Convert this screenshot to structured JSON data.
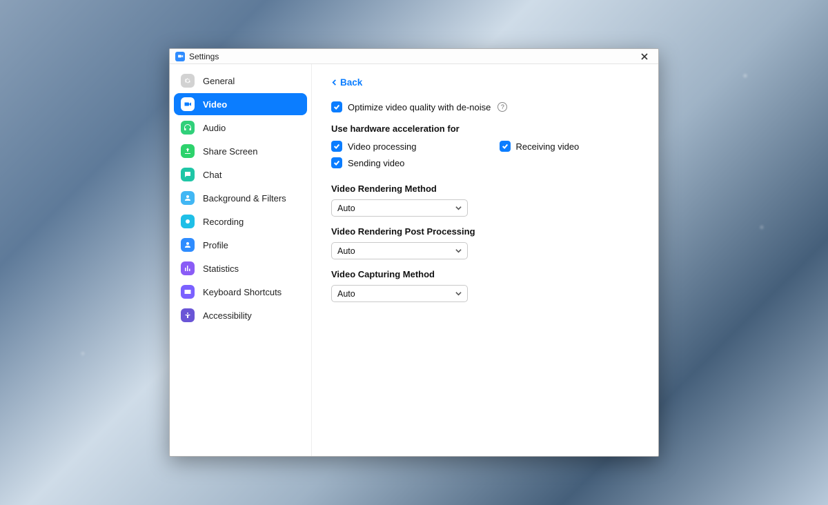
{
  "window": {
    "title": "Settings"
  },
  "sidebar": {
    "items": [
      {
        "label": "General"
      },
      {
        "label": "Video"
      },
      {
        "label": "Audio"
      },
      {
        "label": "Share Screen"
      },
      {
        "label": "Chat"
      },
      {
        "label": "Background & Filters"
      },
      {
        "label": "Recording"
      },
      {
        "label": "Profile"
      },
      {
        "label": "Statistics"
      },
      {
        "label": "Keyboard Shortcuts"
      },
      {
        "label": "Accessibility"
      }
    ]
  },
  "content": {
    "back_label": "Back",
    "optimize_label": "Optimize video quality with de-noise",
    "hw_section_title": "Use hardware acceleration for",
    "hw_video_processing": "Video processing",
    "hw_receiving_video": "Receiving video",
    "hw_sending_video": "Sending video",
    "render_method": {
      "label": "Video Rendering Method",
      "value": "Auto"
    },
    "render_post": {
      "label": "Video Rendering Post Processing",
      "value": "Auto"
    },
    "capture_method": {
      "label": "Video Capturing Method",
      "value": "Auto"
    }
  }
}
